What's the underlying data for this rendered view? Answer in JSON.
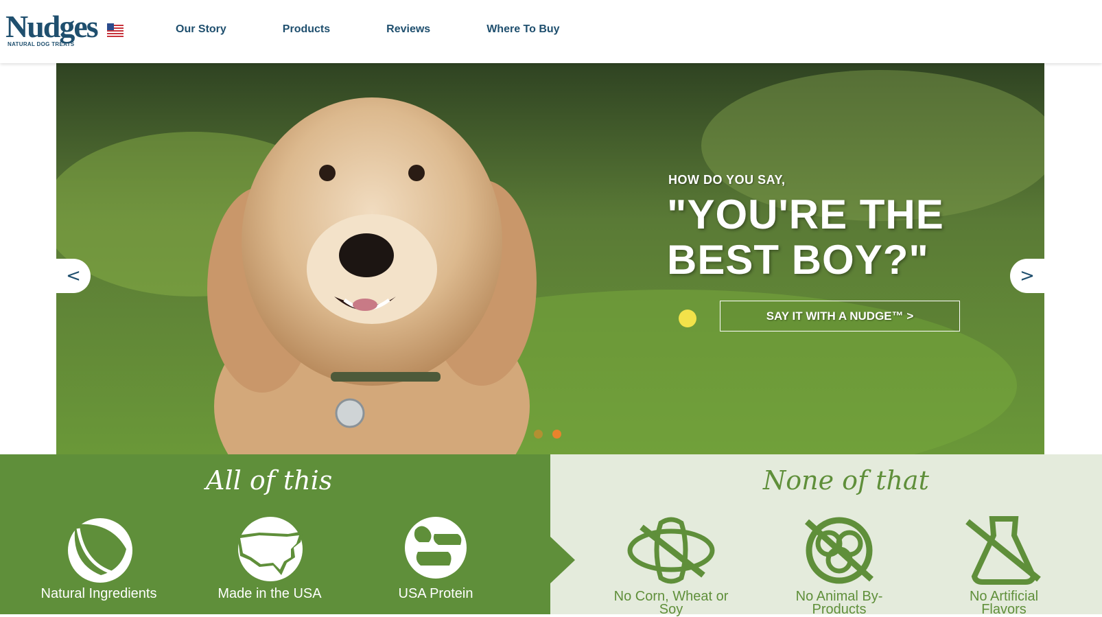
{
  "brand": {
    "name": "Nudges",
    "tagline": "NATURAL DOG TREATS",
    "flag_icon": "us-flag-icon"
  },
  "nav": [
    "Our Story",
    "Products",
    "Reviews",
    "Where To Buy"
  ],
  "hero": {
    "subtitle": "HOW DO YOU SAY,",
    "title": "\"YOU'RE THE BEST BOY?\"",
    "cta": "SAY IT WITH A NUDGE™ >",
    "prev": "<",
    "next": ">",
    "active_slide": 1,
    "slide_count": 2
  },
  "banner": {
    "left_title": "All of this",
    "right_title": "None of that",
    "all": [
      {
        "label": "Natural Ingredients",
        "icon": "leaf-icon"
      },
      {
        "label": "Made in the USA",
        "icon": "usa-map-icon"
      },
      {
        "label": "USA Protein",
        "icon": "farm-animals-icon"
      }
    ],
    "none": [
      {
        "label": "No Corn, Wheat or Soy",
        "icon": "no-corn-icon"
      },
      {
        "label": "No Animal By-Products",
        "icon": "no-byproducts-icon"
      },
      {
        "label": "No Artificial Flavors",
        "icon": "no-flask-icon"
      }
    ]
  },
  "colors": {
    "brand_blue": "#1f4f6e",
    "green": "#5f8f3a",
    "light_green": "#e4ebdc",
    "dot_active": "#e9832c"
  }
}
